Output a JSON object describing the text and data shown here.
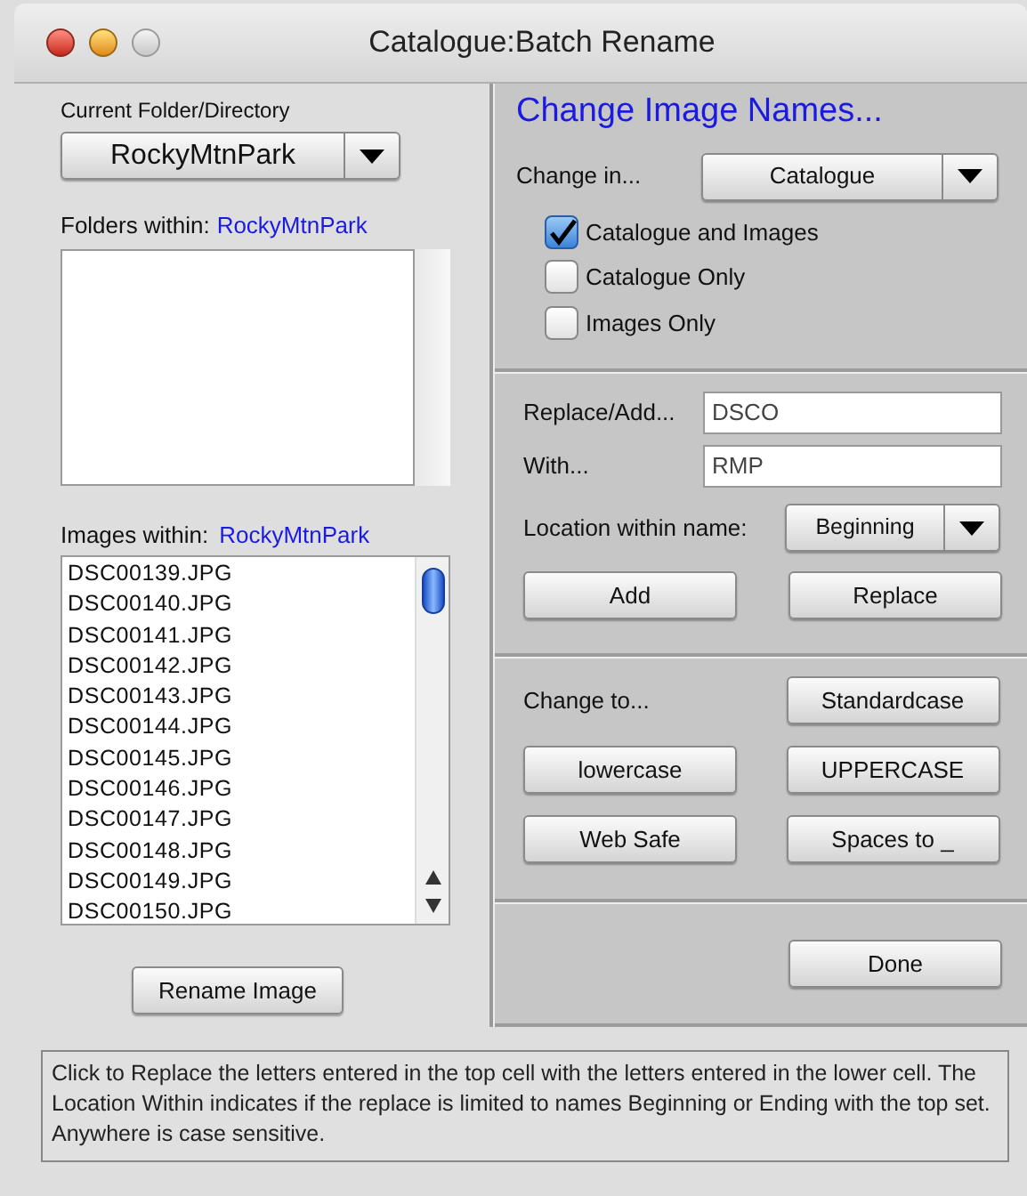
{
  "window": {
    "title": "Catalogue:Batch Rename"
  },
  "left": {
    "current_folder_label": "Current Folder/Directory",
    "current_folder": "RockyMtnPark",
    "folders_label": "Folders within:",
    "folders_name": "RockyMtnPark",
    "images_label": "Images within:",
    "images_name": "RockyMtnPark",
    "images": [
      "DSC00139.JPG",
      "DSC00140.JPG",
      "DSC00141.JPG",
      "DSC00142.JPG",
      "DSC00143.JPG",
      "DSC00144.JPG",
      "DSC00145.JPG",
      "DSC00146.JPG",
      "DSC00147.JPG",
      "DSC00148.JPG",
      "DSC00149.JPG",
      "DSC00150.JPG"
    ],
    "rename_button": "Rename Image"
  },
  "right": {
    "heading": "Change Image Names...",
    "change_in_label": "Change in...",
    "change_in_value": "Catalogue",
    "options": [
      {
        "label": "Catalogue and Images",
        "checked": true
      },
      {
        "label": "Catalogue Only",
        "checked": false
      },
      {
        "label": "Images Only",
        "checked": false
      }
    ],
    "replace_label": "Replace/Add...",
    "replace_value": "DSCO",
    "with_label": "With...",
    "with_value": "RMP",
    "location_label": "Location within name:",
    "location_value": "Beginning",
    "add_button": "Add",
    "replace_button": "Replace",
    "change_to_label": "Change to...",
    "case_buttons": [
      "Standardcase",
      "lowercase",
      "UPPERCASE",
      "Web Safe",
      "Spaces to _"
    ],
    "done_button": "Done"
  },
  "help_text": "Click to Replace the letters entered in the top cell with the letters entered in the lower cell. The Location Within indicates if the replace is limited to names Beginning or Ending with the top set. Anywhere is case sensitive."
}
